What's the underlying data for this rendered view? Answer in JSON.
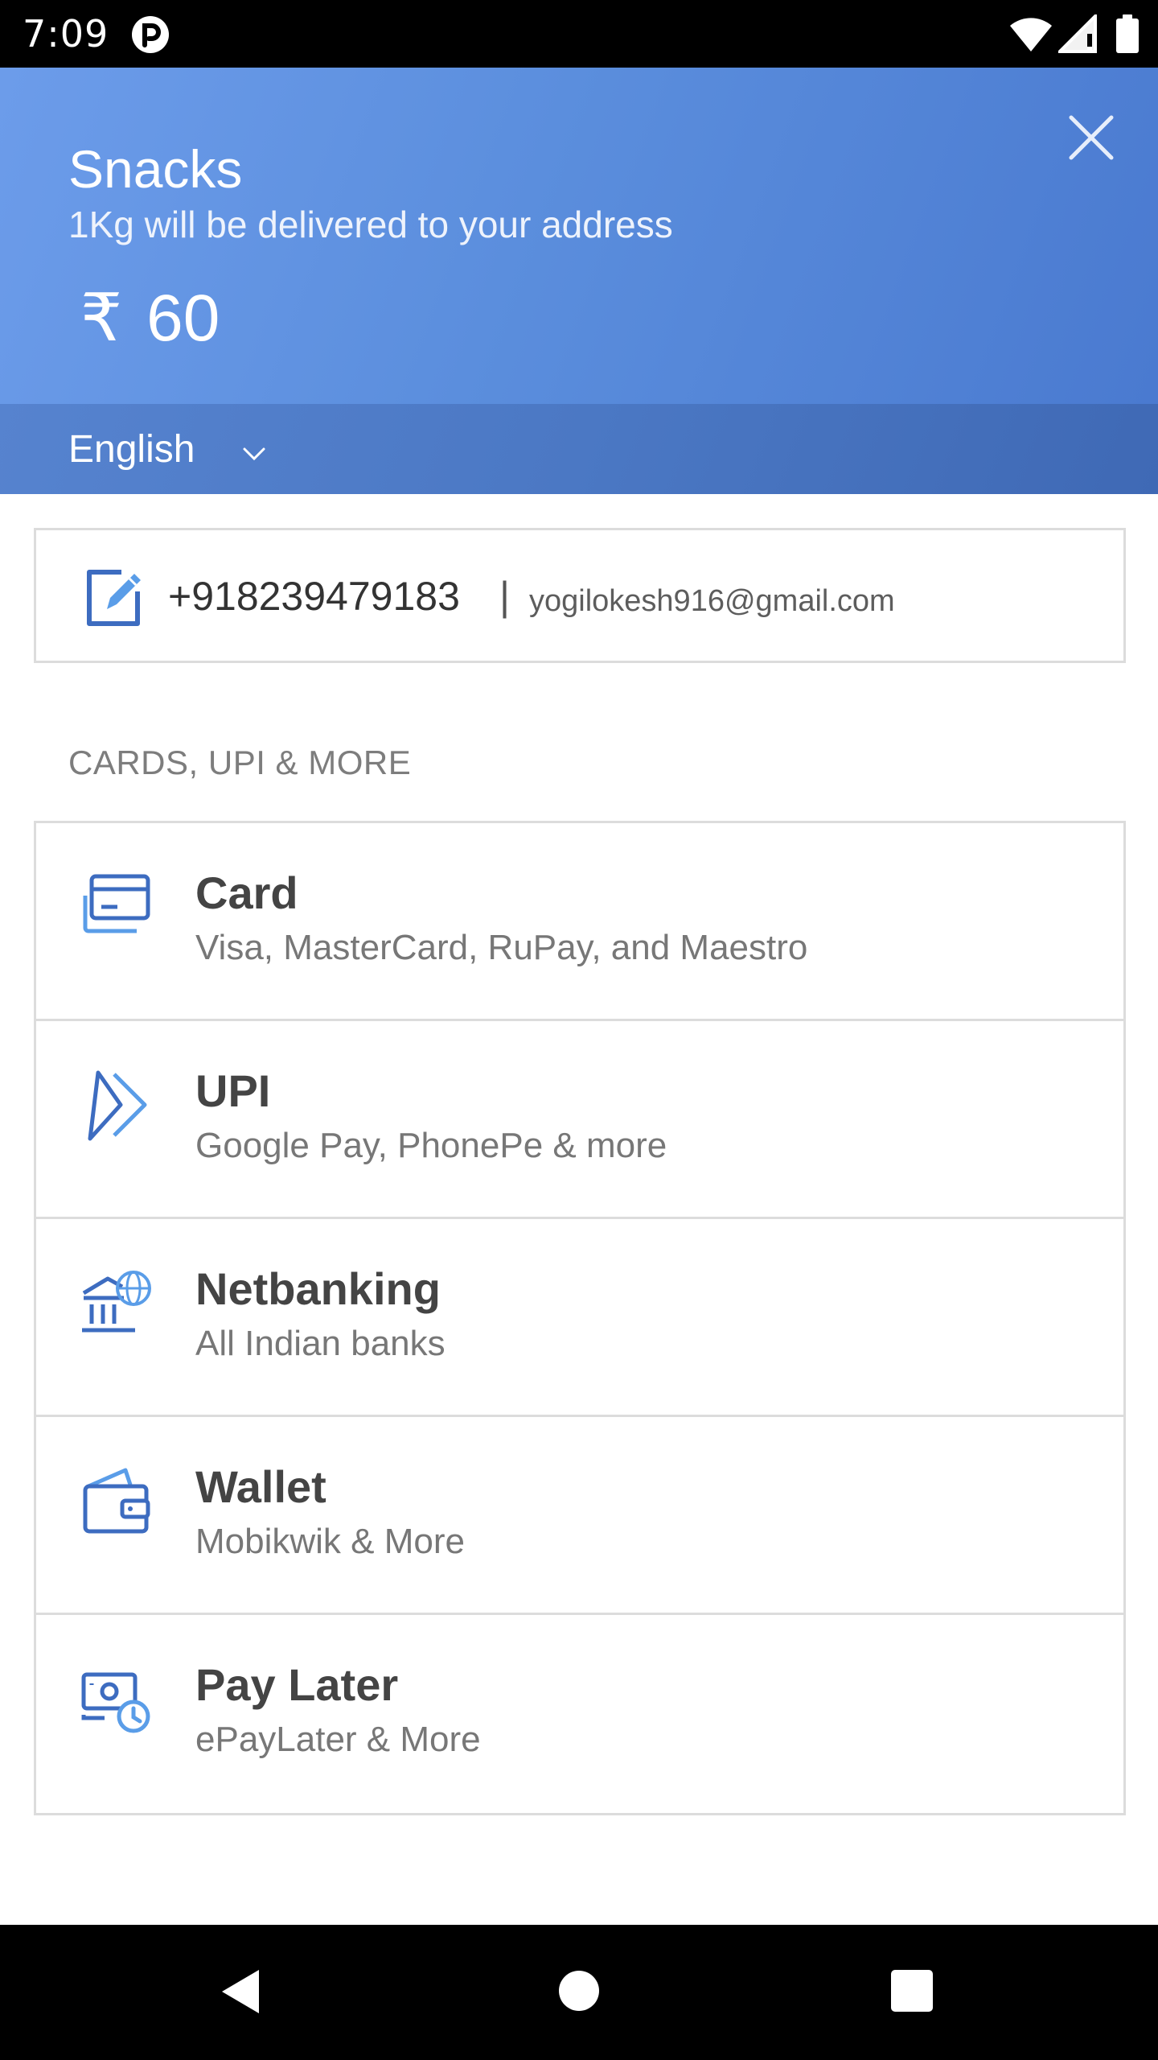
{
  "status_bar": {
    "time": "7:09"
  },
  "header": {
    "product_name": "Snacks",
    "description": "1Kg will be delivered to your address",
    "currency_symbol": "₹",
    "amount": "60",
    "language": "English",
    "colors": {
      "gradient_start": "#6c9cea",
      "gradient_end": "#4a7ad0",
      "lang_bar": "#4b78c4"
    }
  },
  "contact": {
    "phone": "+918239479183",
    "separator": "|",
    "email": "yogilokesh916@gmail.com"
  },
  "section_title": "CARDS, UPI & MORE",
  "methods": [
    {
      "icon": "card-icon",
      "title": "Card",
      "subtitle": "Visa, MasterCard, RuPay, and Maestro"
    },
    {
      "icon": "upi-icon",
      "title": "UPI",
      "subtitle": "Google Pay, PhonePe & more"
    },
    {
      "icon": "netbanking-icon",
      "title": "Netbanking",
      "subtitle": "All Indian banks"
    },
    {
      "icon": "wallet-icon",
      "title": "Wallet",
      "subtitle": "Mobikwik & More"
    },
    {
      "icon": "pay-later-icon",
      "title": "Pay Later",
      "subtitle": "ePayLater & More"
    }
  ],
  "theme": {
    "icon_primary": "#3d6cc0",
    "icon_accent": "#5a9de8"
  }
}
